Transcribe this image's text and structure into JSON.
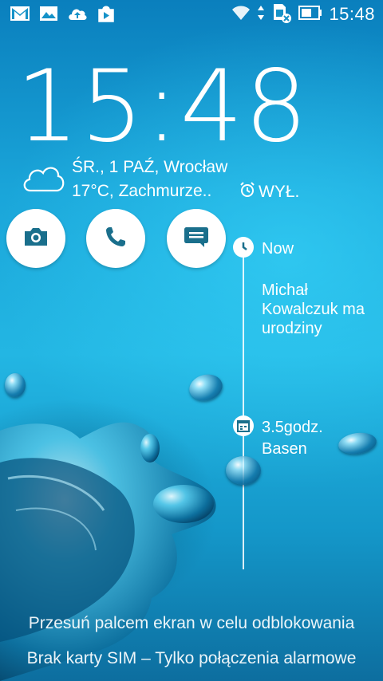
{
  "status_bar": {
    "time": "15:48",
    "left_icons": [
      "gmail-icon",
      "gallery-icon",
      "cloud-upload-icon",
      "play-store-icon"
    ],
    "right_icons": [
      "wifi-icon",
      "data-arrows-icon",
      "no-sim-icon",
      "battery-icon"
    ]
  },
  "lockscreen": {
    "clock": "15:48",
    "date_location": "ŚR., 1 PAŹ, Wrocław",
    "weather": "17°C, Zachmurze..",
    "alarm_label": "WYŁ.",
    "weather_icon": "cloud-icon"
  },
  "shortcuts": [
    {
      "name": "camera",
      "icon": "camera-icon"
    },
    {
      "name": "phone",
      "icon": "phone-icon"
    },
    {
      "name": "messages",
      "icon": "message-icon"
    }
  ],
  "timeline": {
    "now_label": "Now",
    "event1": "Michał Kowalczuk ma urodziny",
    "event2_time": "3.5godz.",
    "event2_title": "Basen"
  },
  "hints": {
    "unlock": "Przesuń palcem ekran w celu odblokowania",
    "sim": "Brak karty SIM – Tylko połączenia alarmowe"
  },
  "colors": {
    "accent": "#1a6f8c",
    "background_top": "#0a7fbd",
    "background_mid": "#23b6e3"
  }
}
